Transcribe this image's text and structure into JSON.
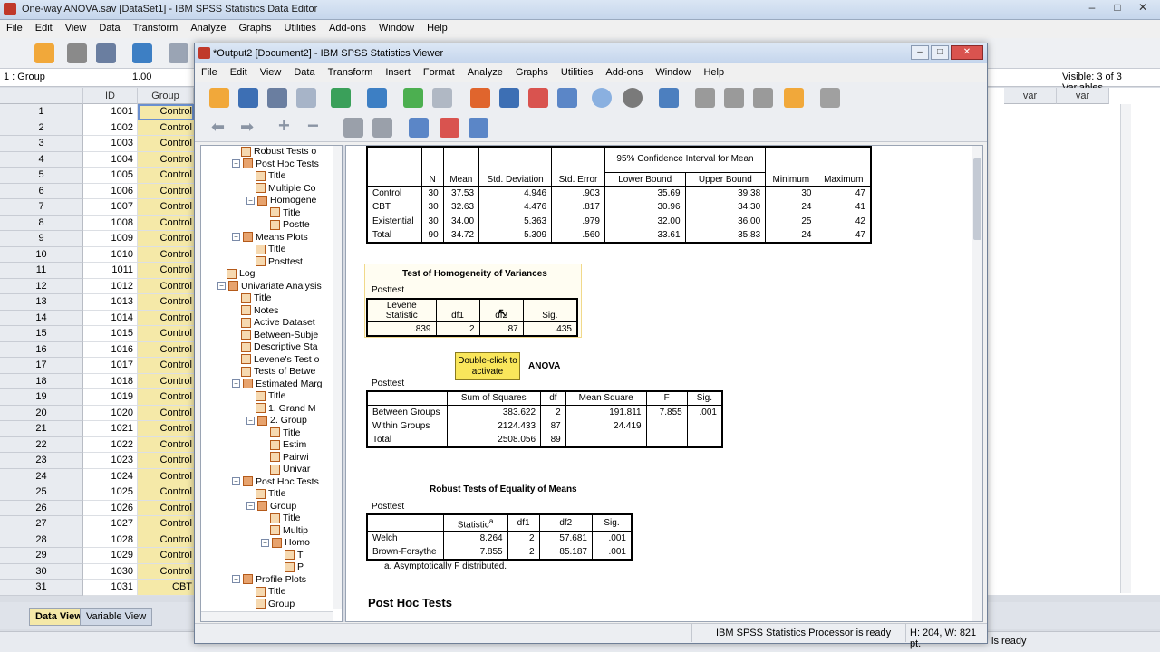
{
  "data_editor": {
    "title": "One-way ANOVA.sav [DataSet1] - IBM SPSS Statistics Data Editor",
    "menu": [
      "File",
      "Edit",
      "View",
      "Data",
      "Transform",
      "Analyze",
      "Graphs",
      "Utilities",
      "Add-ons",
      "Window",
      "Help"
    ],
    "cell_ref": "1 : Group",
    "cell_value": "1.00",
    "visible_vars": "Visible: 3 of 3 Variables",
    "col_id": "ID",
    "col_group": "Group",
    "col_var1": "var",
    "col_var2": "var",
    "rows": [
      {
        "n": "1",
        "id": "1001",
        "g": "Control"
      },
      {
        "n": "2",
        "id": "1002",
        "g": "Control"
      },
      {
        "n": "3",
        "id": "1003",
        "g": "Control"
      },
      {
        "n": "4",
        "id": "1004",
        "g": "Control"
      },
      {
        "n": "5",
        "id": "1005",
        "g": "Control"
      },
      {
        "n": "6",
        "id": "1006",
        "g": "Control"
      },
      {
        "n": "7",
        "id": "1007",
        "g": "Control"
      },
      {
        "n": "8",
        "id": "1008",
        "g": "Control"
      },
      {
        "n": "9",
        "id": "1009",
        "g": "Control"
      },
      {
        "n": "10",
        "id": "1010",
        "g": "Control"
      },
      {
        "n": "11",
        "id": "1011",
        "g": "Control"
      },
      {
        "n": "12",
        "id": "1012",
        "g": "Control"
      },
      {
        "n": "13",
        "id": "1013",
        "g": "Control"
      },
      {
        "n": "14",
        "id": "1014",
        "g": "Control"
      },
      {
        "n": "15",
        "id": "1015",
        "g": "Control"
      },
      {
        "n": "16",
        "id": "1016",
        "g": "Control"
      },
      {
        "n": "17",
        "id": "1017",
        "g": "Control"
      },
      {
        "n": "18",
        "id": "1018",
        "g": "Control"
      },
      {
        "n": "19",
        "id": "1019",
        "g": "Control"
      },
      {
        "n": "20",
        "id": "1020",
        "g": "Control"
      },
      {
        "n": "21",
        "id": "1021",
        "g": "Control"
      },
      {
        "n": "22",
        "id": "1022",
        "g": "Control"
      },
      {
        "n": "23",
        "id": "1023",
        "g": "Control"
      },
      {
        "n": "24",
        "id": "1024",
        "g": "Control"
      },
      {
        "n": "25",
        "id": "1025",
        "g": "Control"
      },
      {
        "n": "26",
        "id": "1026",
        "g": "Control"
      },
      {
        "n": "27",
        "id": "1027",
        "g": "Control"
      },
      {
        "n": "28",
        "id": "1028",
        "g": "Control"
      },
      {
        "n": "29",
        "id": "1029",
        "g": "Control"
      },
      {
        "n": "30",
        "id": "1030",
        "g": "Control"
      },
      {
        "n": "31",
        "id": "1031",
        "g": "CBT"
      }
    ],
    "tab_data": "Data View",
    "tab_variable": "Variable View",
    "status_right": "is ready"
  },
  "viewer": {
    "title": "*Output2 [Document2] - IBM SPSS Statistics Viewer",
    "menu": [
      "File",
      "Edit",
      "View",
      "Data",
      "Transform",
      "Insert",
      "Format",
      "Analyze",
      "Graphs",
      "Utilities",
      "Add-ons",
      "Window",
      "Help"
    ],
    "status": "IBM SPSS Statistics Processor is ready",
    "status_dims": "H: 204, W: 821 pt.",
    "outline": [
      {
        "label": "Robust Tests o",
        "lvl": 3,
        "ic": "doc"
      },
      {
        "label": "Post Hoc Tests",
        "lvl": 3,
        "ic": "book",
        "tog": "−"
      },
      {
        "label": "Title",
        "lvl": 4,
        "ic": "doc"
      },
      {
        "label": "Multiple Co",
        "lvl": 4,
        "ic": "doc"
      },
      {
        "label": "Homogene",
        "lvl": 4,
        "ic": "book",
        "tog": "−"
      },
      {
        "label": "Title",
        "lvl": 5,
        "ic": "doc"
      },
      {
        "label": "Postte",
        "lvl": 5,
        "ic": "doc"
      },
      {
        "label": "Means Plots",
        "lvl": 3,
        "ic": "book",
        "tog": "−"
      },
      {
        "label": "Title",
        "lvl": 4,
        "ic": "doc"
      },
      {
        "label": "Posttest",
        "lvl": 4,
        "ic": "doc"
      },
      {
        "label": "Log",
        "lvl": 2,
        "ic": "doc"
      },
      {
        "label": "Univariate Analysis",
        "lvl": 2,
        "ic": "book",
        "tog": "−"
      },
      {
        "label": "Title",
        "lvl": 3,
        "ic": "doc"
      },
      {
        "label": "Notes",
        "lvl": 3,
        "ic": "doc"
      },
      {
        "label": "Active Dataset",
        "lvl": 3,
        "ic": "doc"
      },
      {
        "label": "Between-Subje",
        "lvl": 3,
        "ic": "doc"
      },
      {
        "label": "Descriptive Sta",
        "lvl": 3,
        "ic": "doc"
      },
      {
        "label": "Levene's Test o",
        "lvl": 3,
        "ic": "doc"
      },
      {
        "label": "Tests of Betwe",
        "lvl": 3,
        "ic": "doc"
      },
      {
        "label": "Estimated Marg",
        "lvl": 3,
        "ic": "book",
        "tog": "−"
      },
      {
        "label": "Title",
        "lvl": 4,
        "ic": "doc"
      },
      {
        "label": "1. Grand M",
        "lvl": 4,
        "ic": "doc"
      },
      {
        "label": "2. Group",
        "lvl": 4,
        "ic": "book",
        "tog": "−"
      },
      {
        "label": "Title",
        "lvl": 5,
        "ic": "doc"
      },
      {
        "label": "Estim",
        "lvl": 5,
        "ic": "doc"
      },
      {
        "label": "Pairwi",
        "lvl": 5,
        "ic": "doc"
      },
      {
        "label": "Univar",
        "lvl": 5,
        "ic": "doc"
      },
      {
        "label": "Post Hoc Tests",
        "lvl": 3,
        "ic": "book",
        "tog": "−"
      },
      {
        "label": "Title",
        "lvl": 4,
        "ic": "doc"
      },
      {
        "label": "Group",
        "lvl": 4,
        "ic": "book",
        "tog": "−"
      },
      {
        "label": "Title",
        "lvl": 5,
        "ic": "doc"
      },
      {
        "label": "Multip",
        "lvl": 5,
        "ic": "doc"
      },
      {
        "label": "Homo",
        "lvl": 5,
        "ic": "book",
        "tog": "−"
      },
      {
        "label": "T",
        "lvl": 6,
        "ic": "doc"
      },
      {
        "label": "P",
        "lvl": 6,
        "ic": "doc"
      },
      {
        "label": "Profile Plots",
        "lvl": 3,
        "ic": "book",
        "tog": "−"
      },
      {
        "label": "Title",
        "lvl": 4,
        "ic": "doc"
      },
      {
        "label": "Group",
        "lvl": 4,
        "ic": "doc"
      }
    ],
    "descriptives": {
      "hdr_ci": "95% Confidence Interval for Mean",
      "cols": [
        "N",
        "Mean",
        "Std. Deviation",
        "Std. Error",
        "Lower Bound",
        "Upper Bound",
        "Minimum",
        "Maximum"
      ],
      "rows": [
        [
          "Control",
          "30",
          "37.53",
          "4.946",
          ".903",
          "35.69",
          "39.38",
          "30",
          "47"
        ],
        [
          "CBT",
          "30",
          "32.63",
          "4.476",
          ".817",
          "30.96",
          "34.30",
          "24",
          "41"
        ],
        [
          "Existential",
          "30",
          "34.00",
          "5.363",
          ".979",
          "32.00",
          "36.00",
          "25",
          "42"
        ],
        [
          "Total",
          "90",
          "34.72",
          "5.309",
          ".560",
          "33.61",
          "35.83",
          "24",
          "47"
        ]
      ]
    },
    "homogeneity": {
      "title": "Test of Homogeneity of Variances",
      "dv": "Posttest",
      "cols": [
        "Levene Statistic",
        "df1",
        "df2",
        "Sig."
      ],
      "row": [
        ".839",
        "2",
        "87",
        ".435"
      ]
    },
    "tooltip": "Double-click to activate",
    "anova": {
      "title": "ANOVA",
      "dv": "Posttest",
      "cols": [
        "Sum of Squares",
        "df",
        "Mean Square",
        "F",
        "Sig."
      ],
      "rows": [
        [
          "Between Groups",
          "383.622",
          "2",
          "191.811",
          "7.855",
          ".001"
        ],
        [
          "Within Groups",
          "2124.433",
          "87",
          "24.419",
          "",
          ""
        ],
        [
          "Total",
          "2508.056",
          "89",
          "",
          "",
          ""
        ]
      ]
    },
    "robust": {
      "title": "Robust Tests of Equality of Means",
      "dv": "Posttest",
      "cols": [
        "Statistic",
        "df1",
        "df2",
        "Sig."
      ],
      "sup": "a",
      "rows": [
        [
          "Welch",
          "8.264",
          "2",
          "57.681",
          ".001"
        ],
        [
          "Brown-Forsythe",
          "7.855",
          "2",
          "85.187",
          ".001"
        ]
      ],
      "footnote": "a. Asymptotically F distributed."
    },
    "posthoc_heading": "Post Hoc Tests"
  }
}
